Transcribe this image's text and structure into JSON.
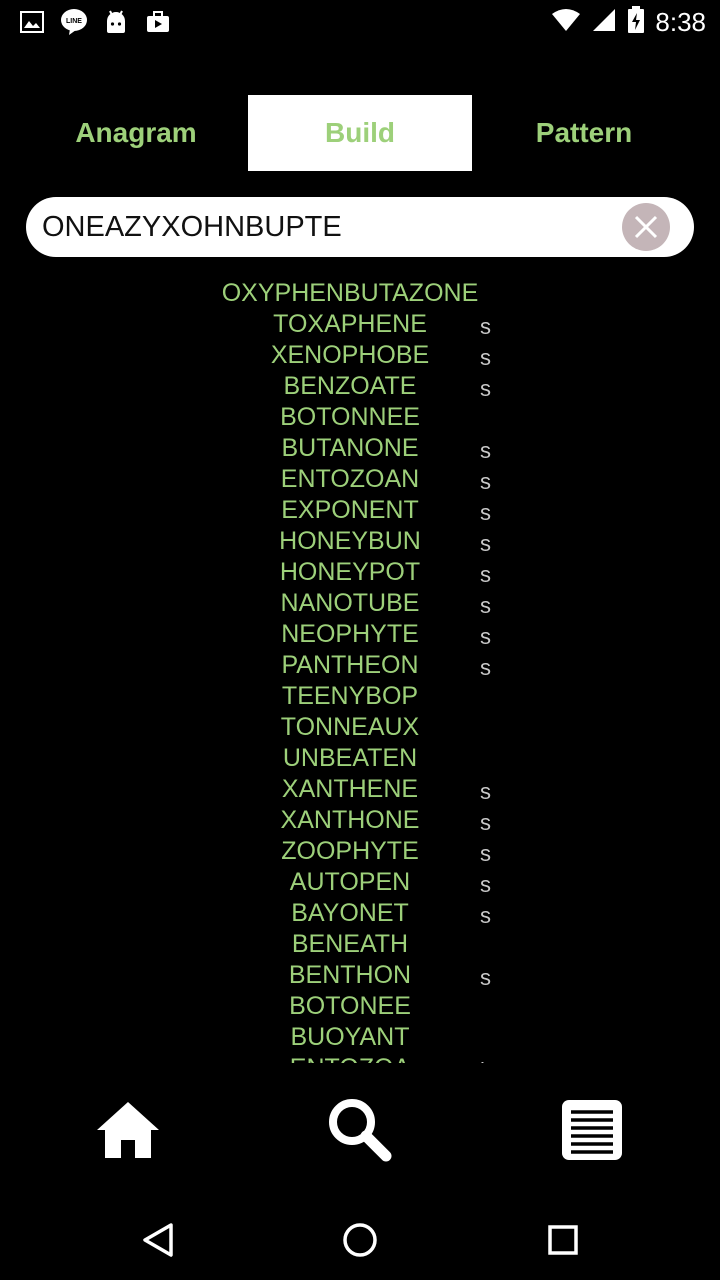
{
  "status_bar": {
    "time": "8:38",
    "icons": [
      "image-icon",
      "line-app-icon",
      "android-icon",
      "briefcase-icon",
      "wifi-icon",
      "signal-icon",
      "battery-charging-icon"
    ]
  },
  "tabs": [
    {
      "label": "Anagram",
      "active": false
    },
    {
      "label": "Build",
      "active": true
    },
    {
      "label": "Pattern",
      "active": false
    }
  ],
  "search": {
    "value": "ONEAZYXOHNBUPTE",
    "placeholder": ""
  },
  "results": [
    {
      "word": "OXYPHENBUTAZONE",
      "suffix": ""
    },
    {
      "word": "TOXAPHENE",
      "suffix": "s"
    },
    {
      "word": "XENOPHOBE",
      "suffix": "s"
    },
    {
      "word": "BENZOATE",
      "suffix": "s"
    },
    {
      "word": "BOTONNEE",
      "suffix": ""
    },
    {
      "word": "BUTANONE",
      "suffix": "s"
    },
    {
      "word": "ENTOZOAN",
      "suffix": "s"
    },
    {
      "word": "EXPONENT",
      "suffix": "s"
    },
    {
      "word": "HONEYBUN",
      "suffix": "s"
    },
    {
      "word": "HONEYPOT",
      "suffix": "s"
    },
    {
      "word": "NANOTUBE",
      "suffix": "s"
    },
    {
      "word": "NEOPHYTE",
      "suffix": "s"
    },
    {
      "word": "PANTHEON",
      "suffix": "s"
    },
    {
      "word": "TEENYBOP",
      "suffix": ""
    },
    {
      "word": "TONNEAUX",
      "suffix": ""
    },
    {
      "word": "UNBEATEN",
      "suffix": ""
    },
    {
      "word": "XANTHENE",
      "suffix": "s"
    },
    {
      "word": "XANTHONE",
      "suffix": "s"
    },
    {
      "word": "ZOOPHYTE",
      "suffix": "s"
    },
    {
      "word": "AUTOPEN",
      "suffix": "s"
    },
    {
      "word": "BAYONET",
      "suffix": "s"
    },
    {
      "word": "BENEATH",
      "suffix": ""
    },
    {
      "word": "BENTHON",
      "suffix": "s"
    },
    {
      "word": "BOTONEE",
      "suffix": ""
    },
    {
      "word": "BUOYANT",
      "suffix": ""
    },
    {
      "word": "ENTOZOA",
      "suffix": "l"
    }
  ],
  "bottom_nav": [
    "home-icon",
    "search-icon",
    "list-icon"
  ],
  "system_nav": [
    "back-icon",
    "home-circle-icon",
    "recents-icon"
  ],
  "colors": {
    "accent_green": "#9dd07a",
    "background": "#000000",
    "suffix_gray": "#c8c8c8",
    "clear_button": "#c4b5b8"
  }
}
